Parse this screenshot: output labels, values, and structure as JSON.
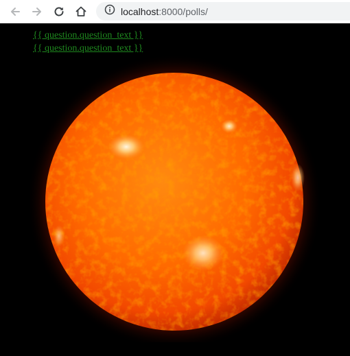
{
  "browser": {
    "url_host": "localhost",
    "url_path": ":8000/polls/"
  },
  "page": {
    "question_links": [
      "{{ question.question_text }}",
      "{{ question.question_text }}"
    ],
    "link_color": "#1f8a1f",
    "background_image": "sun-photo"
  },
  "colors": {
    "sun_core": "#ff6a00",
    "sun_edge": "#c22a00",
    "sun_glow": "#ff3300"
  }
}
